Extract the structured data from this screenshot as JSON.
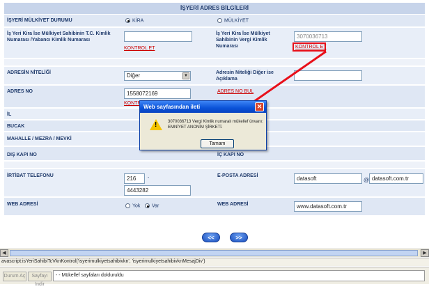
{
  "header": {
    "title": "İŞYERİ ADRES BİLGİLERİ"
  },
  "ownership": {
    "label": "İŞYERİ MÜLKİYET DURUMU",
    "option_rent": "KİRA",
    "option_own": "MÜLKİYET",
    "selected": "rent"
  },
  "owner_tc": {
    "label": "İş Yeri Kira İse Mülkiyet Sahibinin T.C. Kimlik Numarası /Yabancı Kimlik Numarası",
    "value": "",
    "check_link": "KONTROL ET"
  },
  "owner_tax": {
    "label": "İş Yeri Kira İse Mülkiyet Sahibinin Vergi Kimlik Numarası",
    "value": "3070036713",
    "check_link": "KONTROL ET"
  },
  "address_nature": {
    "label": "ADRESİN NİTELİĞİ",
    "selected": "Diğer",
    "other_label": "Adresin Niteliği Diğer ise Açıklama",
    "other_value": ""
  },
  "address_no": {
    "label": "ADRES NO",
    "value": "1558072169",
    "check_link": "KONTROL ET",
    "find_link": "ADRES NO BUL"
  },
  "rows": {
    "il": "İL",
    "bucak": "BUCAK",
    "mahalle": "MAHALLE / MEZRA / MEVKİ",
    "dis_kapi": "DIŞ KAPI NO",
    "ic_kapi": "İÇ KAPI NO"
  },
  "phone": {
    "label": "İRTİBAT TELEFONU",
    "area_code": "216",
    "dash": "-",
    "number": "4443282"
  },
  "email": {
    "label": "E-POSTA ADRESİ",
    "user": "datasoft",
    "at": "@",
    "domain": "datasoft.com.tr"
  },
  "web": {
    "label": "WEB ADRESİ",
    "option_no": "Yok",
    "option_yes": "Var",
    "selected": "yes",
    "label2": "WEB ADRESİ",
    "value": "www.datasoft.com.tr"
  },
  "nav": {
    "prev": "<<",
    "next": ">>"
  },
  "dialog": {
    "title": "Web sayfasından ileti",
    "message": "3070036713 Vergi Kimlik numaralı mükellef ünvanı: EMNİYET ANONİM ŞİRKETİ.",
    "ok": "Tamam"
  },
  "statusline": {
    "text": "avascript:isYeriSahibiTcVknKontrol('isyerimulkiyetsahibivkn', 'isyerimulkiyetsahibivknMesajDiv')"
  },
  "bottombar": {
    "btn1": "Durum Aç",
    "btn2": "Sayfayı İndir",
    "message": "- - Mükellef sayfaları dolduruldu"
  },
  "colors": {
    "accent_red": "#e8101a",
    "title_blue": "#0a52d8"
  }
}
